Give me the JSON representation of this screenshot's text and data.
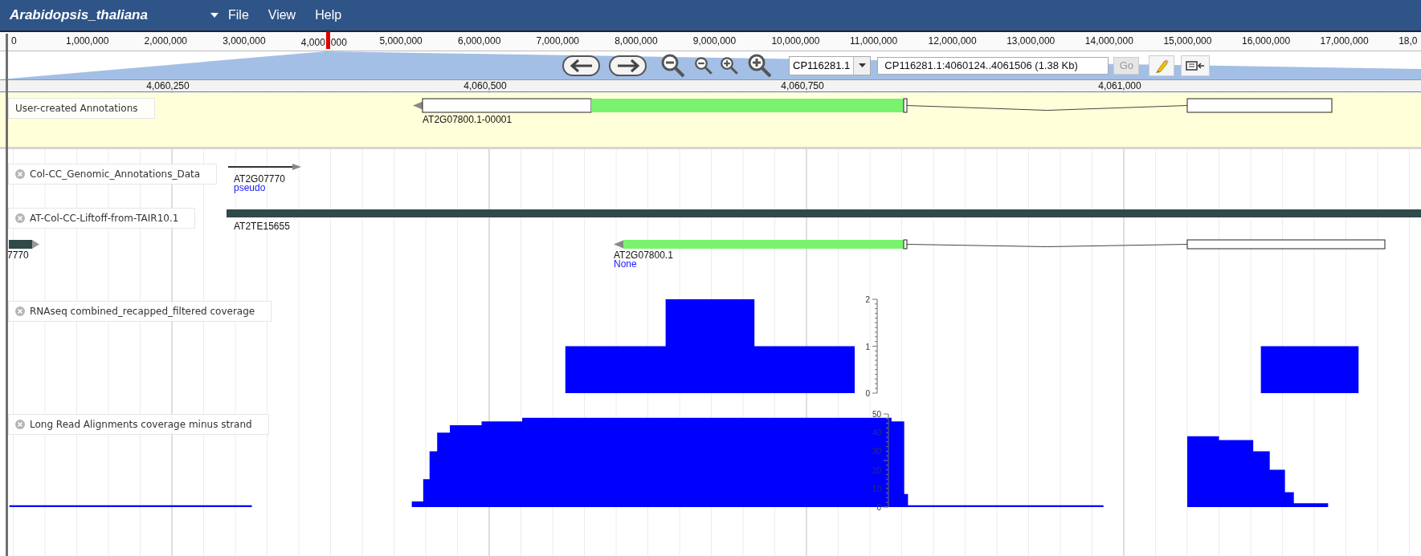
{
  "header": {
    "title": "Arabidopsis_thaliana",
    "menu": [
      "File",
      "View",
      "Help"
    ]
  },
  "overview": {
    "labels": [
      {
        "kind": "text",
        "text": "0"
      },
      {
        "kind": "text",
        "text": "1,000,000"
      },
      {
        "kind": "text",
        "text": "2,000,000"
      },
      {
        "kind": "text",
        "text": "3,000,000"
      },
      {
        "kind": "marked",
        "parts": [
          "4,000",
          "000"
        ]
      },
      {
        "kind": "text",
        "text": "5,000,000"
      },
      {
        "kind": "text",
        "text": "6,000,000"
      },
      {
        "kind": "text",
        "text": "7,000,000"
      },
      {
        "kind": "text",
        "text": "8,000,000"
      },
      {
        "kind": "text",
        "text": "9,000,000"
      },
      {
        "kind": "text",
        "text": "10,000,000"
      },
      {
        "kind": "text",
        "text": "11,000,000"
      },
      {
        "kind": "text",
        "text": "12,000,000"
      },
      {
        "kind": "text",
        "text": "13,000,000"
      },
      {
        "kind": "text",
        "text": "14,000,000"
      },
      {
        "kind": "text",
        "text": "15,000,000"
      },
      {
        "kind": "text",
        "text": "16,000,000"
      },
      {
        "kind": "text",
        "text": "17,000,000"
      },
      {
        "kind": "text",
        "text": "18,0"
      }
    ]
  },
  "navigation": {
    "sequence": "CP116281.1",
    "location": "CP116281.1:4060124..4061506 (1.38 Kb)",
    "go": {
      "label": "Go",
      "disabled": true
    }
  },
  "ruler": [
    "4,060,250",
    "4,060,500",
    "4,060,750",
    "4,061,000"
  ],
  "tracks": [
    {
      "kind": "annotation",
      "label": "User-created Annotations",
      "closable": false,
      "features": [
        {
          "name": "AT2G07800.1-00001"
        }
      ]
    },
    {
      "kind": "genes",
      "label": "Col-CC_Genomic_Annotations_Data",
      "closable": true,
      "features": [
        {
          "name": "AT2G07770",
          "type": "pseudo"
        }
      ]
    },
    {
      "kind": "genes",
      "label": "AT-Col-CC-Liftoff-from-TAIR10.1",
      "closable": true,
      "features": [
        {
          "name": "AT2TE15655"
        },
        {
          "name": "7770"
        },
        {
          "name": "AT2G07800.1",
          "type": "None"
        }
      ]
    },
    {
      "kind": "coverage",
      "label": "RNAseq combined_recapped_filtered coverage",
      "closable": true,
      "axis_ticks": [
        "2",
        "1",
        "0"
      ]
    },
    {
      "kind": "coverage",
      "label": "Long Read Alignments coverage minus strand",
      "closable": true,
      "axis_ticks": [
        "50",
        "40",
        "30",
        "20",
        "10",
        "0"
      ]
    }
  ]
}
